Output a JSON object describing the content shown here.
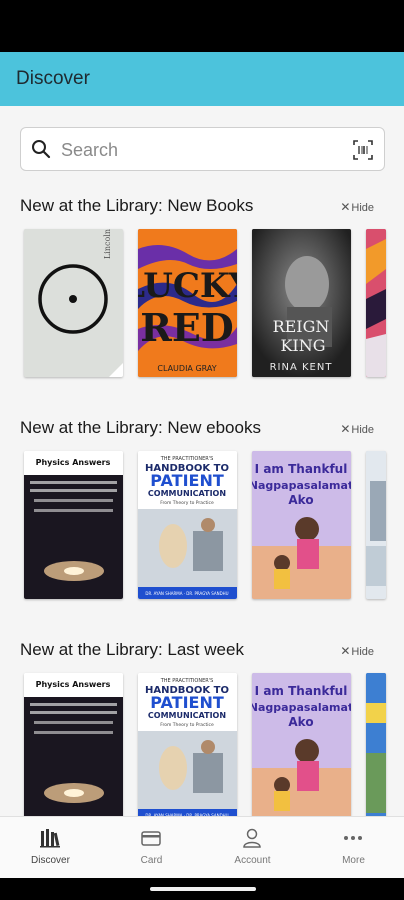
{
  "appbar": {
    "title": "Discover"
  },
  "search": {
    "placeholder": "Search"
  },
  "sections": [
    {
      "title": "New at the Library: New Books",
      "hide_label": "Hide"
    },
    {
      "title": "New at the Library: New ebooks",
      "hide_label": "Hide"
    },
    {
      "title": "New at the Library: Last week",
      "hide_label": "Hide"
    }
  ],
  "covers": {
    "rina": {
      "line1": "REIGN",
      "line2": "KING",
      "author": "RINA KENT"
    },
    "lucky": {
      "title": "LUCKY RED",
      "author": "CLAUDIA GRAY"
    },
    "physics": {
      "title": "Physics Answers"
    },
    "handbook": {
      "kicker": "THE PRACTITIONER'S",
      "line1": "HANDBOOK TO",
      "line2": "PATIENT",
      "line3": "COMMUNICATION",
      "subtitle": "From Theory to Practice",
      "authors": "DR. AYAN SHARMA · DR. PRAGYA SANDHU"
    },
    "thankful": {
      "line1": "I am Thankful",
      "line2": "Nagpapasalamat",
      "line3": "Ako"
    }
  },
  "nav": [
    {
      "label": "Discover",
      "icon": "library-books-icon"
    },
    {
      "label": "Card",
      "icon": "card-icon"
    },
    {
      "label": "Account",
      "icon": "account-icon"
    },
    {
      "label": "More",
      "icon": "more-dots-icon"
    }
  ],
  "colors": {
    "appbar": "#4cc3dc",
    "background": "#f5f5f5"
  }
}
